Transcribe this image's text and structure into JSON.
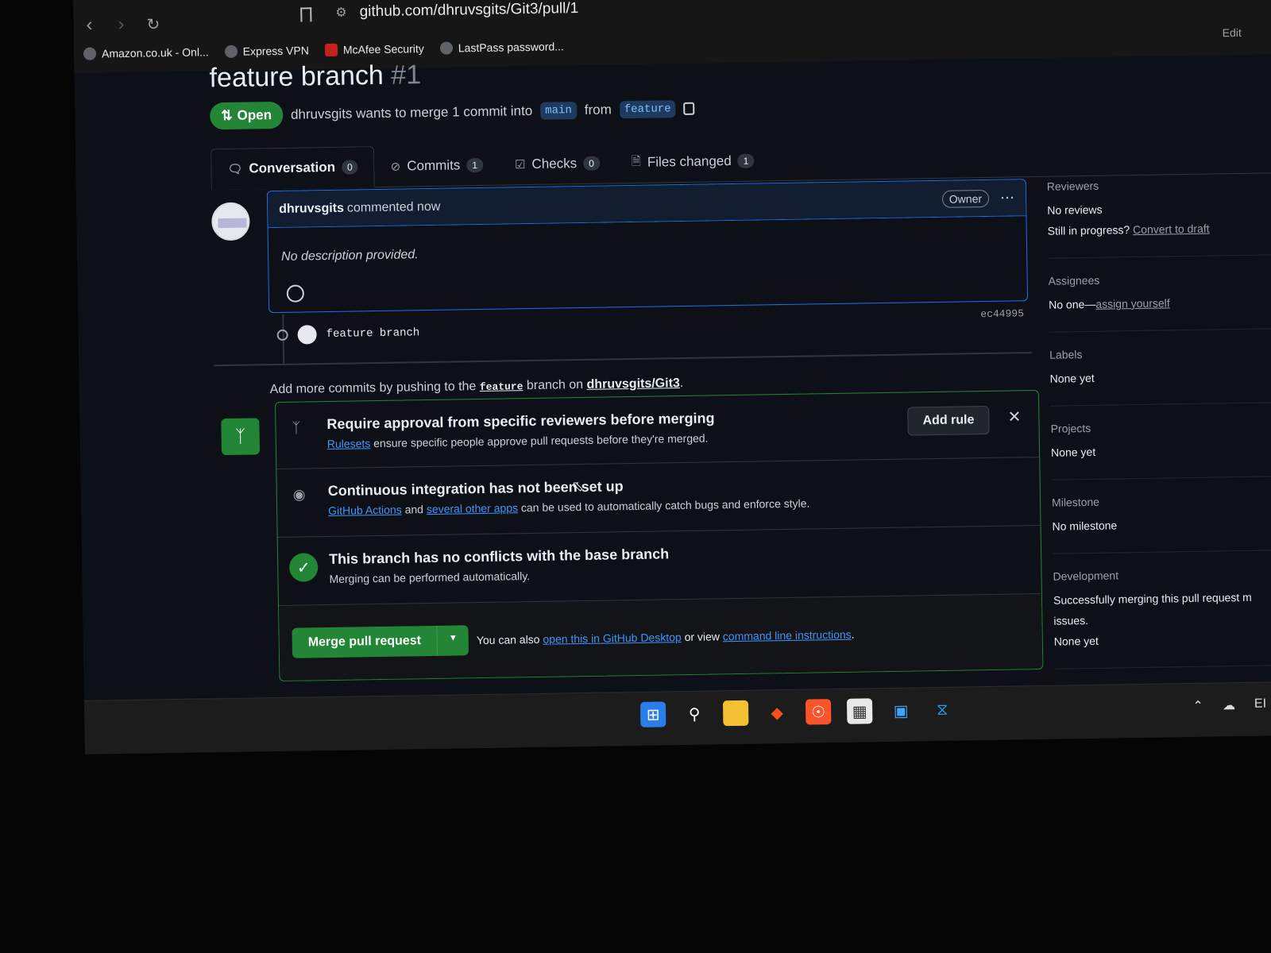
{
  "browser": {
    "url": "github.com/dhruvsgits/Git3/pull/1",
    "bookmarks": [
      "Amazon.co.uk - Onl...",
      "Express VPN",
      "McAfee Security",
      "LastPass password..."
    ],
    "edit": "Edit"
  },
  "pr": {
    "title": "feature branch",
    "number": "#1",
    "state": "Open",
    "merge_text": "dhruvsgits wants to merge 1 commit into",
    "base": "main",
    "from": "from",
    "head": "feature"
  },
  "tabs": [
    {
      "label": "Conversation",
      "count": "0"
    },
    {
      "label": "Commits",
      "count": "1"
    },
    {
      "label": "Checks",
      "count": "0"
    },
    {
      "label": "Files changed",
      "count": "1"
    }
  ],
  "comment": {
    "author": "dhruvsgits",
    "action": "commented now",
    "badge": "Owner",
    "body": "No description provided."
  },
  "commit": {
    "message": "feature branch",
    "sha": "ec44995"
  },
  "push_hint": {
    "prefix": "Add more commits by pushing to the",
    "branch": "feature",
    "middle": "branch on",
    "repo": "dhruvsgits/Git3",
    "suffix": "."
  },
  "merge_box": {
    "rules_title": "Require approval from specific reviewers before merging",
    "rules_link": "Rulesets",
    "rules_text": "ensure specific people approve pull requests before they're merged.",
    "add_rule": "Add rule",
    "ci_title": "Continuous integration has not been set up",
    "ci_link1": "GitHub Actions",
    "ci_and": "and",
    "ci_link2": "several other apps",
    "ci_text": "can be used to automatically catch bugs and enforce style.",
    "conflict_title": "This branch has no conflicts with the base branch",
    "conflict_text": "Merging can be performed automatically.",
    "merge_button": "Merge pull request",
    "merge_hint_prefix": "You can also",
    "merge_hint_link1": "open this in GitHub Desktop",
    "merge_hint_mid": "or view",
    "merge_hint_link2": "command line instructions",
    "merge_hint_suffix": "."
  },
  "sidebar": {
    "reviewers_title": "Reviewers",
    "reviewers_value": "No reviews",
    "reviewers_draft_prefix": "Still in progress?",
    "reviewers_draft_link": "Convert to draft",
    "assignees_title": "Assignees",
    "assignees_value": "No one—",
    "assignees_link": "assign yourself",
    "labels_title": "Labels",
    "labels_value": "None yet",
    "projects_title": "Projects",
    "projects_value": "None yet",
    "milestone_title": "Milestone",
    "milestone_value": "No milestone",
    "development_title": "Development",
    "development_text": "Successfully merging this pull request m",
    "development_text2": "issues.",
    "development_value": "None yet"
  },
  "taskbar": {
    "icons": [
      "windows-start-icon",
      "search-icon",
      "file-explorer-icon",
      "app-icon",
      "brave-browser-icon",
      "store-icon",
      "remote-desktop-icon",
      "vscode-icon"
    ],
    "tray_lang": "EI"
  }
}
